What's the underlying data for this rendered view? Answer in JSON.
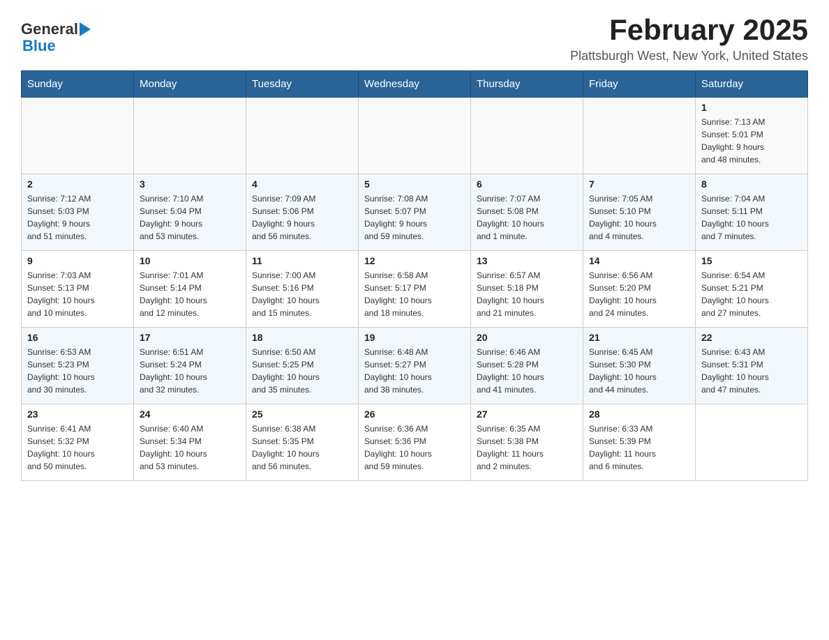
{
  "header": {
    "logo_general": "General",
    "logo_blue": "Blue",
    "month_title": "February 2025",
    "location": "Plattsburgh West, New York, United States"
  },
  "weekdays": [
    "Sunday",
    "Monday",
    "Tuesday",
    "Wednesday",
    "Thursday",
    "Friday",
    "Saturday"
  ],
  "rows": [
    {
      "cells": [
        {
          "day": "",
          "info": ""
        },
        {
          "day": "",
          "info": ""
        },
        {
          "day": "",
          "info": ""
        },
        {
          "day": "",
          "info": ""
        },
        {
          "day": "",
          "info": ""
        },
        {
          "day": "",
          "info": ""
        },
        {
          "day": "1",
          "info": "Sunrise: 7:13 AM\nSunset: 5:01 PM\nDaylight: 9 hours\nand 48 minutes."
        }
      ]
    },
    {
      "cells": [
        {
          "day": "2",
          "info": "Sunrise: 7:12 AM\nSunset: 5:03 PM\nDaylight: 9 hours\nand 51 minutes."
        },
        {
          "day": "3",
          "info": "Sunrise: 7:10 AM\nSunset: 5:04 PM\nDaylight: 9 hours\nand 53 minutes."
        },
        {
          "day": "4",
          "info": "Sunrise: 7:09 AM\nSunset: 5:06 PM\nDaylight: 9 hours\nand 56 minutes."
        },
        {
          "day": "5",
          "info": "Sunrise: 7:08 AM\nSunset: 5:07 PM\nDaylight: 9 hours\nand 59 minutes."
        },
        {
          "day": "6",
          "info": "Sunrise: 7:07 AM\nSunset: 5:08 PM\nDaylight: 10 hours\nand 1 minute."
        },
        {
          "day": "7",
          "info": "Sunrise: 7:05 AM\nSunset: 5:10 PM\nDaylight: 10 hours\nand 4 minutes."
        },
        {
          "day": "8",
          "info": "Sunrise: 7:04 AM\nSunset: 5:11 PM\nDaylight: 10 hours\nand 7 minutes."
        }
      ]
    },
    {
      "cells": [
        {
          "day": "9",
          "info": "Sunrise: 7:03 AM\nSunset: 5:13 PM\nDaylight: 10 hours\nand 10 minutes."
        },
        {
          "day": "10",
          "info": "Sunrise: 7:01 AM\nSunset: 5:14 PM\nDaylight: 10 hours\nand 12 minutes."
        },
        {
          "day": "11",
          "info": "Sunrise: 7:00 AM\nSunset: 5:16 PM\nDaylight: 10 hours\nand 15 minutes."
        },
        {
          "day": "12",
          "info": "Sunrise: 6:58 AM\nSunset: 5:17 PM\nDaylight: 10 hours\nand 18 minutes."
        },
        {
          "day": "13",
          "info": "Sunrise: 6:57 AM\nSunset: 5:18 PM\nDaylight: 10 hours\nand 21 minutes."
        },
        {
          "day": "14",
          "info": "Sunrise: 6:56 AM\nSunset: 5:20 PM\nDaylight: 10 hours\nand 24 minutes."
        },
        {
          "day": "15",
          "info": "Sunrise: 6:54 AM\nSunset: 5:21 PM\nDaylight: 10 hours\nand 27 minutes."
        }
      ]
    },
    {
      "cells": [
        {
          "day": "16",
          "info": "Sunrise: 6:53 AM\nSunset: 5:23 PM\nDaylight: 10 hours\nand 30 minutes."
        },
        {
          "day": "17",
          "info": "Sunrise: 6:51 AM\nSunset: 5:24 PM\nDaylight: 10 hours\nand 32 minutes."
        },
        {
          "day": "18",
          "info": "Sunrise: 6:50 AM\nSunset: 5:25 PM\nDaylight: 10 hours\nand 35 minutes."
        },
        {
          "day": "19",
          "info": "Sunrise: 6:48 AM\nSunset: 5:27 PM\nDaylight: 10 hours\nand 38 minutes."
        },
        {
          "day": "20",
          "info": "Sunrise: 6:46 AM\nSunset: 5:28 PM\nDaylight: 10 hours\nand 41 minutes."
        },
        {
          "day": "21",
          "info": "Sunrise: 6:45 AM\nSunset: 5:30 PM\nDaylight: 10 hours\nand 44 minutes."
        },
        {
          "day": "22",
          "info": "Sunrise: 6:43 AM\nSunset: 5:31 PM\nDaylight: 10 hours\nand 47 minutes."
        }
      ]
    },
    {
      "cells": [
        {
          "day": "23",
          "info": "Sunrise: 6:41 AM\nSunset: 5:32 PM\nDaylight: 10 hours\nand 50 minutes."
        },
        {
          "day": "24",
          "info": "Sunrise: 6:40 AM\nSunset: 5:34 PM\nDaylight: 10 hours\nand 53 minutes."
        },
        {
          "day": "25",
          "info": "Sunrise: 6:38 AM\nSunset: 5:35 PM\nDaylight: 10 hours\nand 56 minutes."
        },
        {
          "day": "26",
          "info": "Sunrise: 6:36 AM\nSunset: 5:36 PM\nDaylight: 10 hours\nand 59 minutes."
        },
        {
          "day": "27",
          "info": "Sunrise: 6:35 AM\nSunset: 5:38 PM\nDaylight: 11 hours\nand 2 minutes."
        },
        {
          "day": "28",
          "info": "Sunrise: 6:33 AM\nSunset: 5:39 PM\nDaylight: 11 hours\nand 6 minutes."
        },
        {
          "day": "",
          "info": ""
        }
      ]
    }
  ]
}
